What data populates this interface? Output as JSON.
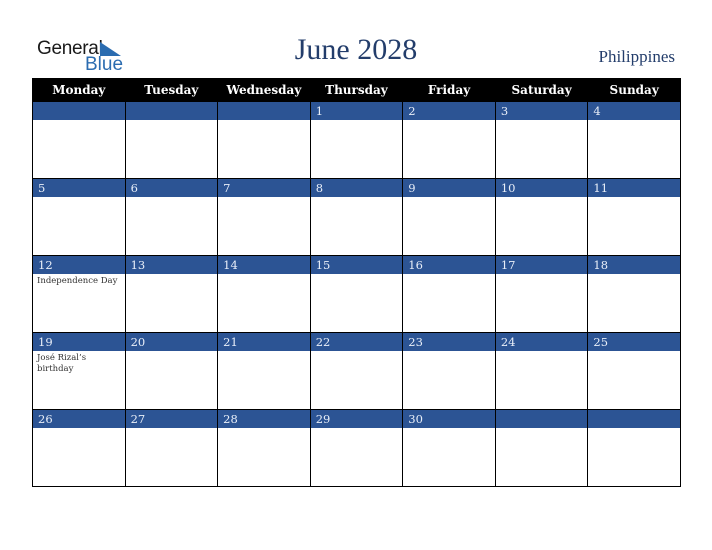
{
  "logo": {
    "general": "General",
    "blue": "Blue"
  },
  "header": {
    "title": "June 2028",
    "country": "Philippines"
  },
  "colors": {
    "band": "#2c5494",
    "header_bg": "#000000",
    "title": "#233d6b"
  },
  "weekdays": [
    "Monday",
    "Tuesday",
    "Wednesday",
    "Thursday",
    "Friday",
    "Saturday",
    "Sunday"
  ],
  "weeks": [
    [
      {
        "day": "",
        "event": ""
      },
      {
        "day": "",
        "event": ""
      },
      {
        "day": "",
        "event": ""
      },
      {
        "day": "1",
        "event": ""
      },
      {
        "day": "2",
        "event": ""
      },
      {
        "day": "3",
        "event": ""
      },
      {
        "day": "4",
        "event": ""
      }
    ],
    [
      {
        "day": "5",
        "event": ""
      },
      {
        "day": "6",
        "event": ""
      },
      {
        "day": "7",
        "event": ""
      },
      {
        "day": "8",
        "event": ""
      },
      {
        "day": "9",
        "event": ""
      },
      {
        "day": "10",
        "event": ""
      },
      {
        "day": "11",
        "event": ""
      }
    ],
    [
      {
        "day": "12",
        "event": "Independence Day"
      },
      {
        "day": "13",
        "event": ""
      },
      {
        "day": "14",
        "event": ""
      },
      {
        "day": "15",
        "event": ""
      },
      {
        "day": "16",
        "event": ""
      },
      {
        "day": "17",
        "event": ""
      },
      {
        "day": "18",
        "event": ""
      }
    ],
    [
      {
        "day": "19",
        "event": "José Rizal’s birthday"
      },
      {
        "day": "20",
        "event": ""
      },
      {
        "day": "21",
        "event": ""
      },
      {
        "day": "22",
        "event": ""
      },
      {
        "day": "23",
        "event": ""
      },
      {
        "day": "24",
        "event": ""
      },
      {
        "day": "25",
        "event": ""
      }
    ],
    [
      {
        "day": "26",
        "event": ""
      },
      {
        "day": "27",
        "event": ""
      },
      {
        "day": "28",
        "event": ""
      },
      {
        "day": "29",
        "event": ""
      },
      {
        "day": "30",
        "event": ""
      },
      {
        "day": "",
        "event": ""
      },
      {
        "day": "",
        "event": ""
      }
    ]
  ]
}
